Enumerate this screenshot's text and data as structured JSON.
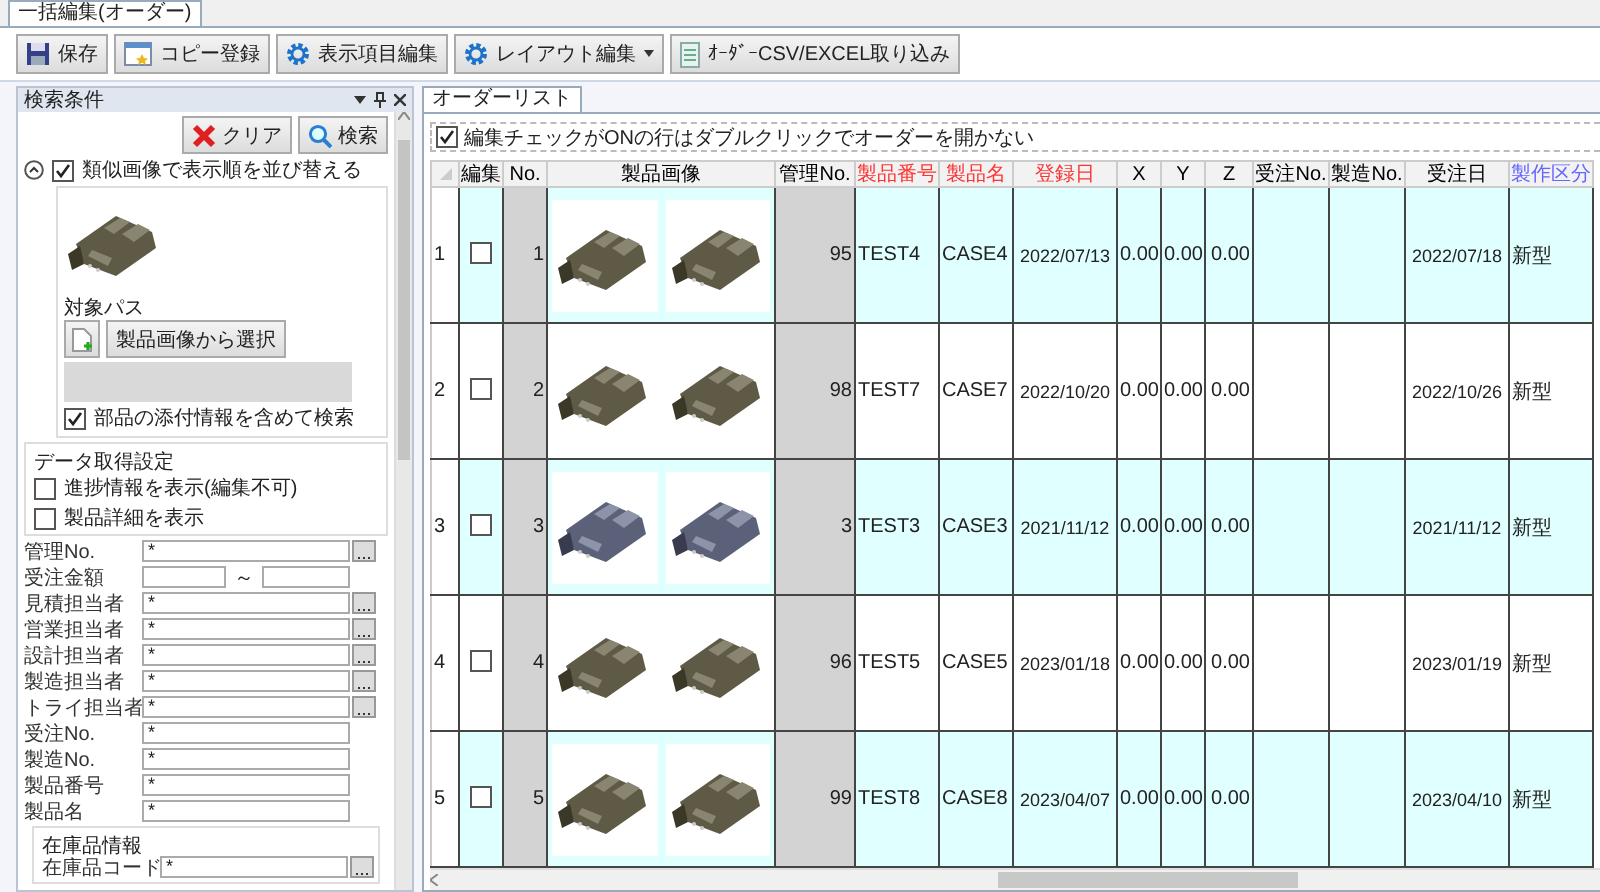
{
  "window": {
    "tab": "一括編集(オーダー)"
  },
  "toolbar": [
    {
      "label": "保存",
      "kind": "button"
    },
    {
      "label": "コピー登録",
      "kind": "button"
    },
    {
      "label": "表示項目編集",
      "kind": "button"
    },
    {
      "label": "レイアウト編集",
      "kind": "dropdown"
    },
    {
      "label": "ｵｰﾀﾞｰCSV/EXCEL取り込み",
      "kind": "button"
    }
  ],
  "search_panel": {
    "title": "検索条件",
    "buttons": [
      {
        "label": "クリア"
      },
      {
        "label": "検索"
      }
    ],
    "similar_image": {
      "expanded": true,
      "checked": true,
      "label": "類似画像で表示順を並び替える",
      "path_label": "対象パス",
      "select_button": "製品画像から選択",
      "include_attachments": {
        "label": "部品の添付情報を含めて検索",
        "checked": true
      }
    },
    "data_settings": {
      "title": "データ取得設定",
      "options": [
        {
          "label": "進捗情報を表示(編集不可)",
          "checked": false
        },
        {
          "label": "製品詳細を表示",
          "checked": false
        }
      ]
    },
    "fields": [
      {
        "label": "管理No.",
        "kind": "lookup",
        "value": "*"
      },
      {
        "label": "受注金額",
        "kind": "range",
        "separator": "～"
      },
      {
        "label": "見積担当者",
        "kind": "lookup",
        "value": "*"
      },
      {
        "label": "営業担当者",
        "kind": "lookup",
        "value": "*"
      },
      {
        "label": "設計担当者",
        "kind": "lookup",
        "value": "*"
      },
      {
        "label": "製造担当者",
        "kind": "lookup",
        "value": "*"
      },
      {
        "label": "トライ担当者",
        "kind": "lookup",
        "value": "*"
      },
      {
        "label": "受注No.",
        "kind": "text",
        "value": "*"
      },
      {
        "label": "製造No.",
        "kind": "text",
        "value": "*"
      },
      {
        "label": "製品番号",
        "kind": "text",
        "value": "*"
      },
      {
        "label": "製品名",
        "kind": "text",
        "value": "*"
      }
    ],
    "stock": {
      "title": "在庫品情報",
      "fields": [
        {
          "label": "在庫品コード",
          "kind": "lookup",
          "value": "*"
        }
      ]
    }
  },
  "order_list": {
    "tab": "オーダーリスト",
    "option": {
      "label": "編集チェックがONの行はダブルクリックでオーダーを開かない",
      "checked": true
    },
    "columns": [
      {
        "label": "編集",
        "color": "#000000"
      },
      {
        "label": "No.",
        "color": "#000000"
      },
      {
        "label": "製品画像",
        "color": "#000000"
      },
      {
        "label": "管理No.",
        "color": "#000000"
      },
      {
        "label": "製品番号",
        "color": "#ff3333"
      },
      {
        "label": "製品名",
        "color": "#ff3333"
      },
      {
        "label": "登録日",
        "color": "#ff3333"
      },
      {
        "label": "X",
        "color": "#000000"
      },
      {
        "label": "Y",
        "color": "#000000"
      },
      {
        "label": "Z",
        "color": "#000000"
      },
      {
        "label": "受注No.",
        "color": "#000000"
      },
      {
        "label": "製造No.",
        "color": "#000000"
      },
      {
        "label": "受注日",
        "color": "#000000"
      },
      {
        "label": "製作区分",
        "color": "#6666ff"
      }
    ],
    "rows": [
      {
        "header": "1",
        "cells": [
          {
            "kind": "checkbox",
            "checked": false
          },
          {
            "kind": "text",
            "text": "1"
          },
          {
            "kind": "images",
            "images": [
              {
                "kind": "olive"
              },
              {
                "kind": "olive"
              }
            ]
          },
          {
            "kind": "text",
            "text": "95"
          },
          {
            "kind": "text",
            "text": "TEST4"
          },
          {
            "kind": "text",
            "text": "CASE4"
          },
          {
            "kind": "text",
            "text": "2022/07/13"
          },
          {
            "kind": "text",
            "text": "0.00"
          },
          {
            "kind": "text",
            "text": "0.00"
          },
          {
            "kind": "text",
            "text": "0.00"
          },
          {
            "kind": "empty"
          },
          {
            "kind": "empty"
          },
          {
            "kind": "text",
            "text": "2022/07/18"
          },
          {
            "kind": "text",
            "text": "新型"
          }
        ]
      },
      {
        "header": "2",
        "cells": [
          {
            "kind": "checkbox",
            "checked": false
          },
          {
            "kind": "text",
            "text": "2"
          },
          {
            "kind": "images",
            "images": [
              {
                "kind": "olive"
              },
              {
                "kind": "olive"
              }
            ]
          },
          {
            "kind": "text",
            "text": "98"
          },
          {
            "kind": "text",
            "text": "TEST7"
          },
          {
            "kind": "text",
            "text": "CASE7"
          },
          {
            "kind": "text",
            "text": "2022/10/20"
          },
          {
            "kind": "text",
            "text": "0.00"
          },
          {
            "kind": "text",
            "text": "0.00"
          },
          {
            "kind": "text",
            "text": "0.00"
          },
          {
            "kind": "empty"
          },
          {
            "kind": "empty"
          },
          {
            "kind": "text",
            "text": "2022/10/26"
          },
          {
            "kind": "text",
            "text": "新型"
          }
        ]
      },
      {
        "header": "3",
        "cells": [
          {
            "kind": "checkbox",
            "checked": false
          },
          {
            "kind": "text",
            "text": "3"
          },
          {
            "kind": "images",
            "images": [
              {
                "kind": "blue"
              },
              {
                "kind": "blue"
              }
            ]
          },
          {
            "kind": "text",
            "text": "3"
          },
          {
            "kind": "text",
            "text": "TEST3"
          },
          {
            "kind": "text",
            "text": "CASE3"
          },
          {
            "kind": "text",
            "text": "2021/11/12"
          },
          {
            "kind": "text",
            "text": "0.00"
          },
          {
            "kind": "text",
            "text": "0.00"
          },
          {
            "kind": "text",
            "text": "0.00"
          },
          {
            "kind": "empty"
          },
          {
            "kind": "empty"
          },
          {
            "kind": "text",
            "text": "2021/11/12"
          },
          {
            "kind": "text",
            "text": "新型"
          }
        ]
      },
      {
        "header": "4",
        "cells": [
          {
            "kind": "checkbox",
            "checked": false
          },
          {
            "kind": "text",
            "text": "4"
          },
          {
            "kind": "images",
            "images": [
              {
                "kind": "olive"
              },
              {
                "kind": "olive"
              }
            ]
          },
          {
            "kind": "text",
            "text": "96"
          },
          {
            "kind": "text",
            "text": "TEST5"
          },
          {
            "kind": "text",
            "text": "CASE5"
          },
          {
            "kind": "text",
            "text": "2023/01/18"
          },
          {
            "kind": "text",
            "text": "0.00"
          },
          {
            "kind": "text",
            "text": "0.00"
          },
          {
            "kind": "text",
            "text": "0.00"
          },
          {
            "kind": "empty"
          },
          {
            "kind": "empty"
          },
          {
            "kind": "text",
            "text": "2023/01/19"
          },
          {
            "kind": "text",
            "text": "新型"
          }
        ]
      },
      {
        "header": "5",
        "cells": [
          {
            "kind": "checkbox",
            "checked": false
          },
          {
            "kind": "text",
            "text": "5"
          },
          {
            "kind": "images",
            "images": [
              {
                "kind": "olive"
              },
              {
                "kind": "olive"
              }
            ]
          },
          {
            "kind": "text",
            "text": "99"
          },
          {
            "kind": "text",
            "text": "TEST8"
          },
          {
            "kind": "text",
            "text": "CASE8"
          },
          {
            "kind": "text",
            "text": "2023/04/07"
          },
          {
            "kind": "text",
            "text": "0.00"
          },
          {
            "kind": "text",
            "text": "0.00"
          },
          {
            "kind": "text",
            "text": "0.00"
          },
          {
            "kind": "empty"
          },
          {
            "kind": "empty"
          },
          {
            "kind": "text",
            "text": "2023/04/10"
          },
          {
            "kind": "text",
            "text": "新型"
          }
        ]
      }
    ]
  }
}
